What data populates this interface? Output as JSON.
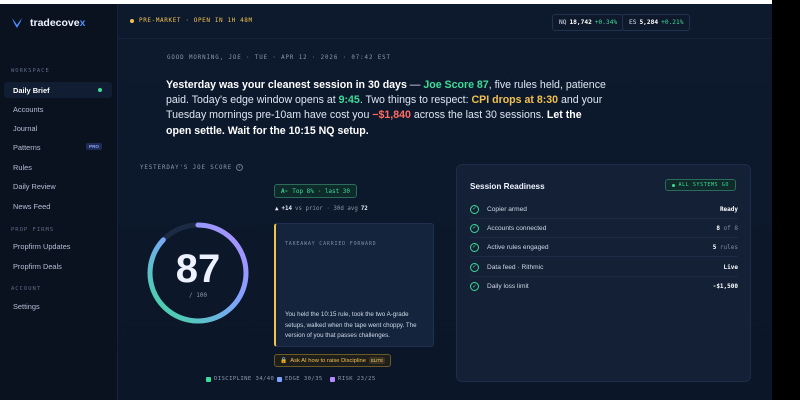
{
  "app": {
    "brand_main": "tradecove",
    "brand_accent": "x",
    "accent_color": "#3ddc97"
  },
  "sidebar": {
    "sections": {
      "workspace": "WORKSPACE",
      "prop_firms": "PROP FIRMS",
      "account": "ACCOUNT"
    },
    "items": [
      {
        "label": "Daily Brief"
      },
      {
        "label": "Accounts"
      },
      {
        "label": "Journal"
      },
      {
        "label": "Patterns",
        "badge": "PRO"
      },
      {
        "label": "Rules"
      },
      {
        "label": "Daily Review"
      },
      {
        "label": "News Feed"
      },
      {
        "label": "Propfirm Updates"
      },
      {
        "label": "Propfirm Deals"
      },
      {
        "label": "Settings"
      }
    ]
  },
  "topbar": {
    "premarket": "PRE-MARKET · OPEN IN 1H 48M",
    "tickers": [
      {
        "symbol": "NQ",
        "price": "18,742",
        "change": "+0.34%"
      },
      {
        "symbol": "ES",
        "price": "5,284",
        "change": "+0.21%"
      }
    ]
  },
  "brief": {
    "greeting": "GOOD MORNING, JOE   ·   TUE · APR 12 · 2026 · 07:42 EST",
    "headline": {
      "p1": "Yesterday was your cleanest session in 30 days",
      "p2": " — ",
      "p3": "Joe Score 87",
      "p4": ", five rules held, patience paid. Today's edge window opens at ",
      "p5": "9:45",
      "p6": ". Two things to respect: ",
      "p7": "CPI drops at 8:30",
      "p8": " and your Tuesday mornings pre-10am have cost you ",
      "p9": "−$1,840",
      "p10": " across the last 30 sessions. ",
      "p11": "Let the open settle. Wait for the 10:15 NQ setup."
    }
  },
  "score": {
    "label": "YESTERDAY'S JOE SCORE",
    "info_icon": "i",
    "value": "87",
    "max": "/ 100",
    "fraction": 0.87,
    "rank_pill": "Top 8% · last 30",
    "delta_arrow": "▲",
    "delta": "+14",
    "delta_text": "vs prior · 30d avg",
    "delta_avg": "72",
    "takeaway_label": "TAKEAWAY CARRIED FORWARD",
    "takeaway_body": "You held the 10:15 rule, took the two A-grade setups, walked when the tape went choppy. The version of you that passes challenges.",
    "ask_ai": "Ask AI how to raise Discipline",
    "ask_ai_badge": "ELITE",
    "legend": [
      {
        "label": "DISCIPLINE 34/40",
        "color": "#3ddc97"
      },
      {
        "label": "EDGE 30/35",
        "color": "#7fa3ff"
      },
      {
        "label": "RISK 23/25",
        "color": "#b48cff"
      }
    ]
  },
  "readiness": {
    "title": "Session Readiness",
    "status": "ALL SYSTEMS GO",
    "rows": [
      {
        "label": "Copier armed",
        "value": "Ready",
        "suffix": ""
      },
      {
        "label": "Accounts connected",
        "value": "8",
        "suffix": " of 8"
      },
      {
        "label": "Active rules engaged",
        "value": "5",
        "suffix": " rules"
      },
      {
        "label": "Data feed · Rithmic",
        "value": "Live",
        "suffix": ""
      },
      {
        "label": "Daily loss limit",
        "value": "-$1,500",
        "suffix": ""
      }
    ]
  }
}
